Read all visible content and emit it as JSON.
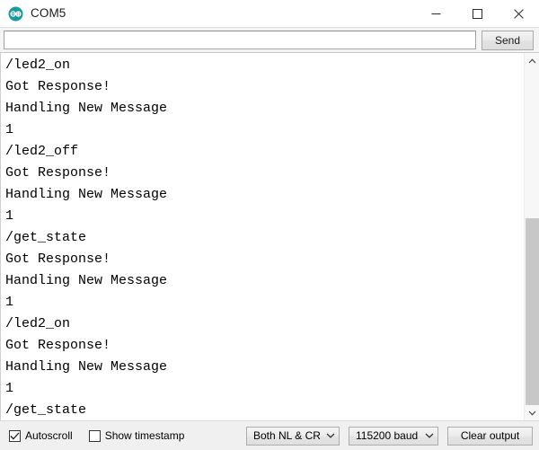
{
  "window": {
    "title": "COM5",
    "icon": "arduino-logo-icon",
    "accent_color": "#00979c",
    "minimize_label": "Minimize",
    "maximize_label": "Maximize",
    "close_label": "Close"
  },
  "command_bar": {
    "input_value": "",
    "input_placeholder": "",
    "send_label": "Send"
  },
  "console": {
    "lines": [
      "/led2_on",
      "Got Response!",
      "Handling New Message",
      "1",
      "/led2_off",
      "Got Response!",
      "Handling New Message",
      "1",
      "/get_state",
      "Got Response!",
      "Handling New Message",
      "1",
      "/led2_on",
      "Got Response!",
      "Handling New Message",
      "1",
      "/get_state"
    ]
  },
  "scrollbar": {
    "up_arrow": "chevron-up-icon",
    "down_arrow": "chevron-down-icon"
  },
  "status_bar": {
    "autoscroll_label": "Autoscroll",
    "autoscroll_checked": true,
    "show_timestamp_label": "Show timestamp",
    "show_timestamp_checked": false,
    "line_ending_value": "Both NL & CR",
    "baud_value": "115200 baud",
    "clear_label": "Clear output"
  }
}
